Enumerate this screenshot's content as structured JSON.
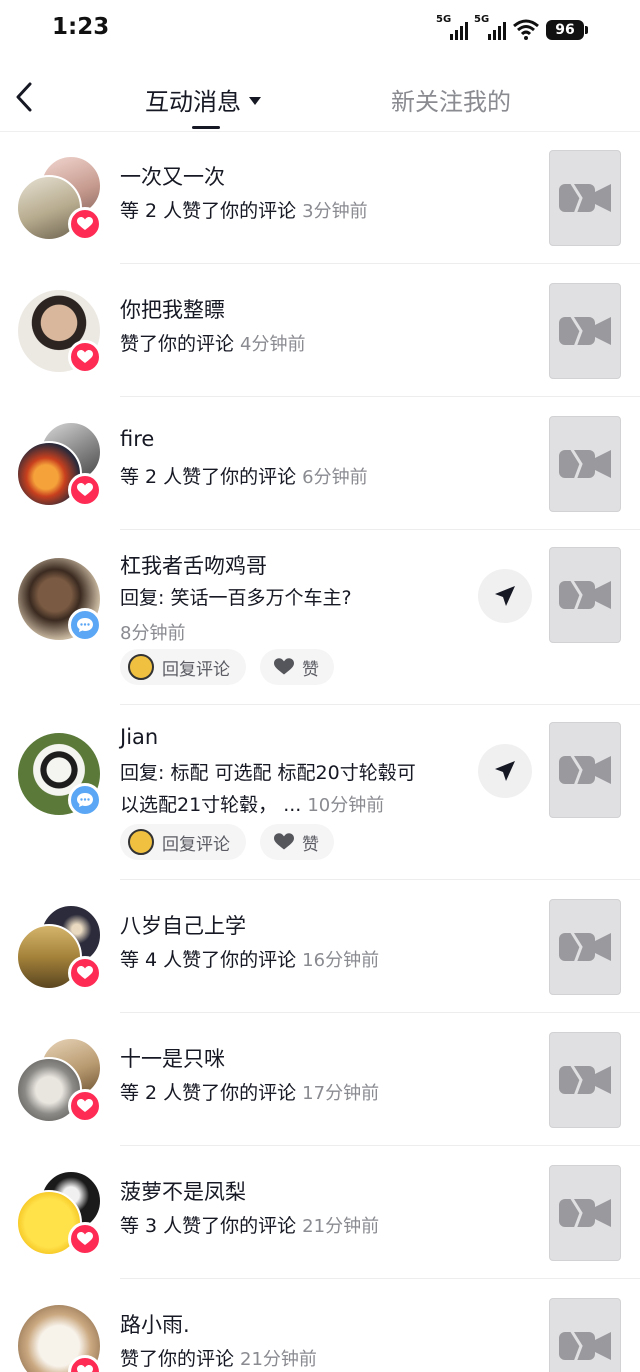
{
  "status_bar": {
    "time": "1:23",
    "network_1": "5G",
    "network_2": "5G",
    "battery": "96"
  },
  "nav": {
    "tab_interactions": "互动消息",
    "tab_new_followers": "新关注我的"
  },
  "items": [
    {
      "name": "一次又一次",
      "text": "等 2 人赞了你的评论",
      "time": "3分钟前",
      "kind": "like",
      "multi": true
    },
    {
      "name": "你把我整瞟",
      "text": "赞了你的评论",
      "time": "4分钟前",
      "kind": "like",
      "multi": false
    },
    {
      "name": "fire",
      "text": "等 2 人赞了你的评论",
      "time": "6分钟前",
      "kind": "like",
      "multi": true
    },
    {
      "name": "杠我者舌吻鸡哥",
      "text": "回复: 笑话一百多万个车主?",
      "time": "8分钟前",
      "kind": "reply",
      "multi": false
    },
    {
      "name": "Jian",
      "text_line1": "回复: 标配 可选配  标配20寸轮毂可",
      "text_line2": "以选配21寸轮毂，  ...",
      "time": "10分钟前",
      "kind": "reply",
      "multi": false
    },
    {
      "name": "八岁自己上学",
      "text": "等 4 人赞了你的评论",
      "time": "16分钟前",
      "kind": "like",
      "multi": true
    },
    {
      "name": "十一是只咪",
      "text": "等 2 人赞了你的评论",
      "time": "17分钟前",
      "kind": "like",
      "multi": true
    },
    {
      "name": "菠萝不是凤梨",
      "text": "等 3 人赞了你的评论",
      "time": "21分钟前",
      "kind": "like",
      "multi": true
    },
    {
      "name": "路小雨.",
      "text": "赞了你的评论",
      "time": "21分钟前",
      "kind": "like",
      "multi": false
    }
  ],
  "actions": {
    "reply_comment": "回复评论",
    "like": "赞"
  },
  "colors": {
    "like_badge": "#fe2c55",
    "comment_badge": "#5ba7f5",
    "secondary_text": "#8a8b91"
  }
}
